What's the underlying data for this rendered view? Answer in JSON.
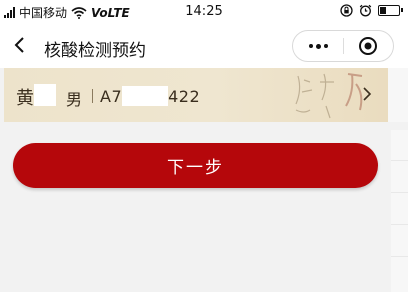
{
  "status_bar": {
    "carrier": "中国移动",
    "network": "VoLTE",
    "time": "14:25"
  },
  "nav": {
    "title": "核酸检测预约"
  },
  "patient": {
    "surname": "黄",
    "gender": "男",
    "id_prefix": "A7",
    "id_suffix": "422"
  },
  "actions": {
    "next_label": "下一步"
  },
  "colors": {
    "primary": "#b5070b",
    "card_bg": "#ede3cb",
    "page_bg": "#f2f2f2"
  }
}
